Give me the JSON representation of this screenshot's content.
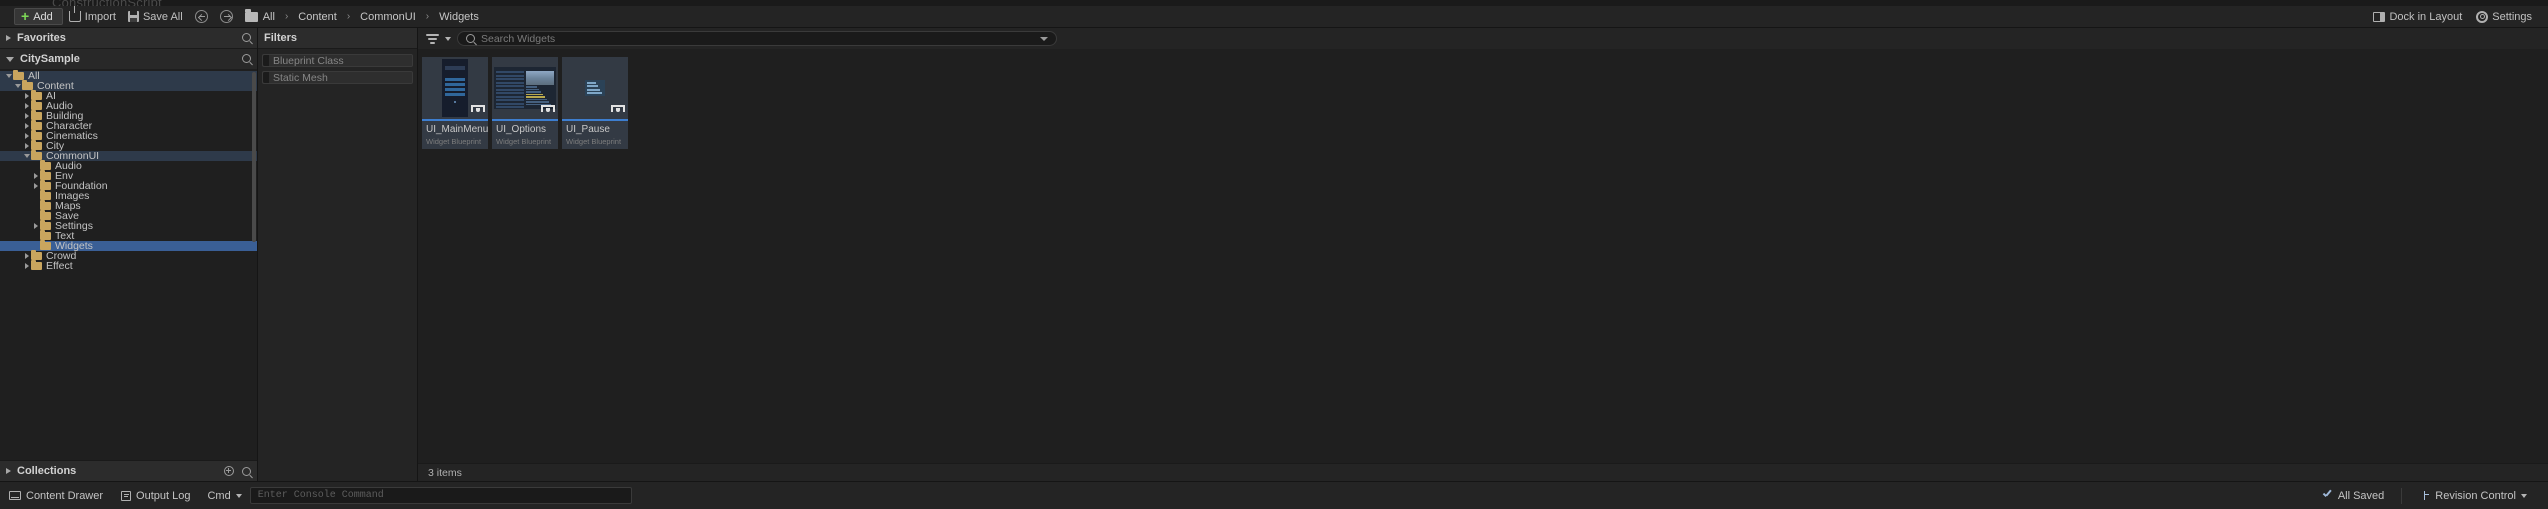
{
  "ghost": {
    "text": "ConstructionScript"
  },
  "toolbar": {
    "add_label": "Add",
    "import_label": "Import",
    "save_all_label": "Save All",
    "back_icon": "arrow-left-circle-icon",
    "forward_icon": "arrow-right-circle-icon",
    "breadcrumb": [
      "All",
      "Content",
      "CommonUI",
      "Widgets"
    ],
    "breadcrumb_sep": "›",
    "dock_layout_label": "Dock in Layout",
    "settings_label": "Settings"
  },
  "left_panel": {
    "favorites_label": "Favorites",
    "project_label": "CitySample",
    "collections_label": "Collections",
    "tree": [
      {
        "label": "All",
        "depth": 0,
        "arrow": "down",
        "state": "selected"
      },
      {
        "label": "Content",
        "depth": 1,
        "arrow": "down",
        "state": "selected"
      },
      {
        "label": "AI",
        "depth": 2,
        "arrow": "right",
        "state": "none"
      },
      {
        "label": "Audio",
        "depth": 2,
        "arrow": "right",
        "state": "none"
      },
      {
        "label": "Building",
        "depth": 2,
        "arrow": "right",
        "state": "none"
      },
      {
        "label": "Character",
        "depth": 2,
        "arrow": "right",
        "state": "none"
      },
      {
        "label": "Cinematics",
        "depth": 2,
        "arrow": "right",
        "state": "none"
      },
      {
        "label": "City",
        "depth": 2,
        "arrow": "right",
        "state": "none"
      },
      {
        "label": "CommonUI",
        "depth": 2,
        "arrow": "down",
        "state": "selected"
      },
      {
        "label": "Audio",
        "depth": 3,
        "arrow": "none",
        "state": "none"
      },
      {
        "label": "Env",
        "depth": 3,
        "arrow": "right",
        "state": "none"
      },
      {
        "label": "Foundation",
        "depth": 3,
        "arrow": "right",
        "state": "none"
      },
      {
        "label": "Images",
        "depth": 3,
        "arrow": "none",
        "state": "none"
      },
      {
        "label": "Maps",
        "depth": 3,
        "arrow": "none",
        "state": "none"
      },
      {
        "label": "Save",
        "depth": 3,
        "arrow": "none",
        "state": "none"
      },
      {
        "label": "Settings",
        "depth": 3,
        "arrow": "right",
        "state": "none"
      },
      {
        "label": "Text",
        "depth": 3,
        "arrow": "none",
        "state": "none"
      },
      {
        "label": "Widgets",
        "depth": 3,
        "arrow": "none",
        "state": "active"
      },
      {
        "label": "Crowd",
        "depth": 2,
        "arrow": "right",
        "state": "none"
      },
      {
        "label": "Effect",
        "depth": 2,
        "arrow": "right",
        "state": "none"
      }
    ]
  },
  "filters_panel": {
    "title": "Filters",
    "items": [
      "Blueprint Class",
      "Static Mesh"
    ]
  },
  "content_panel": {
    "filter_icon": "filter-icon",
    "search_placeholder": "Search Widgets",
    "status_text": "3 items",
    "assets": [
      {
        "name": "UI_MainMenu",
        "type": "Widget Blueprint",
        "thumb": "main-menu",
        "selected": true
      },
      {
        "name": "UI_Options",
        "type": "Widget Blueprint",
        "thumb": "options",
        "selected": true
      },
      {
        "name": "UI_Pause",
        "type": "Widget Blueprint",
        "thumb": "pause",
        "selected": true
      }
    ]
  },
  "bottom_bar": {
    "content_drawer_label": "Content Drawer",
    "output_log_label": "Output Log",
    "cmd_label": "Cmd",
    "console_placeholder": "Enter Console Command",
    "all_saved_label": "All Saved",
    "revision_control_label": "Revision Control"
  },
  "colors": {
    "accent_blue": "#3d7ed0",
    "selection": "#3a5f96",
    "folder": "#c9a55e",
    "add_green": "#7ed957",
    "panel_bg": "#242424",
    "list_bg": "#1f1f1f"
  }
}
